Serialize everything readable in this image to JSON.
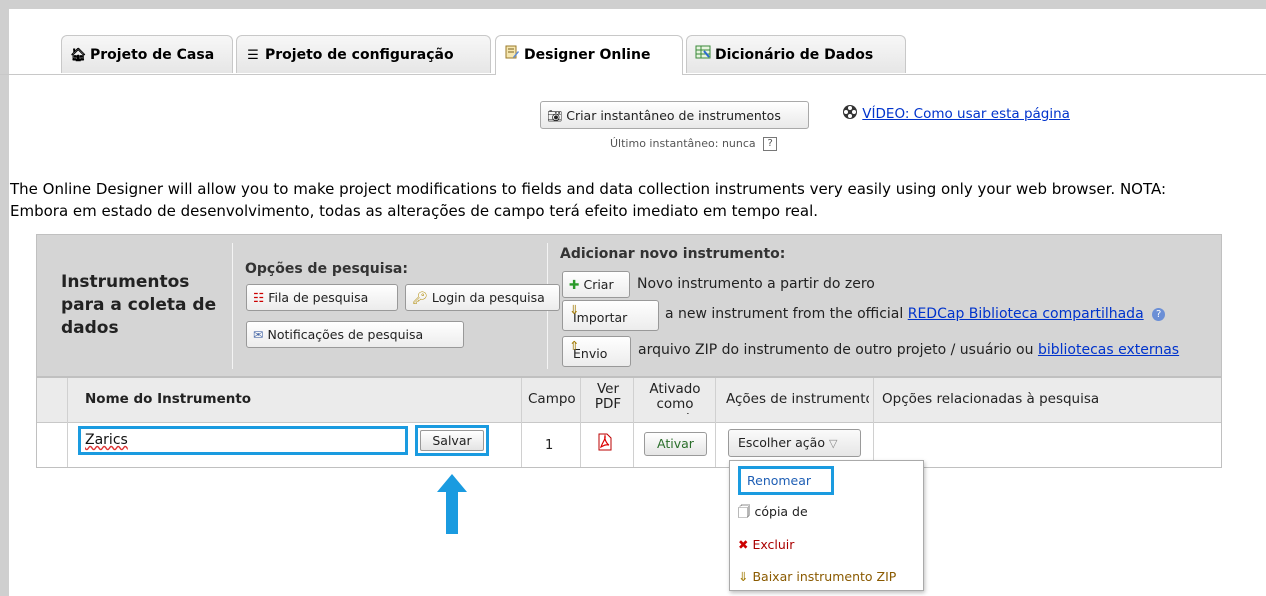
{
  "tabs": [
    {
      "label": "Projeto de Casa",
      "icon": "home-icon",
      "active": false
    },
    {
      "label": "Projeto de configuração",
      "icon": "list-icon",
      "active": false
    },
    {
      "label": "Designer Online",
      "icon": "designer-icon",
      "active": true
    },
    {
      "label": "Dicionário de Dados",
      "icon": "spreadsheet-icon",
      "active": false
    }
  ],
  "snapshot": {
    "button_label": "Criar instantâneo de instrumentos",
    "last_label": "Último instantâneo:",
    "last_value": "nunca",
    "help": "?"
  },
  "video": {
    "link_text": "VÍDEO: Como usar esta página"
  },
  "description": "The Online Designer will allow you to make project modifications to fields and data collection instruments very easily using only your web browser. NOTA: Embora em estado de desenvolvimento, todas as alterações de campo terá efeito imediato em tempo real.",
  "panel": {
    "title": "Instrumentos para a coleta de dados",
    "survey_options_label": "Opções de pesquisa:",
    "survey_queue_button": "Fila de pesquisa",
    "survey_login_button": "Login da pesquisa",
    "survey_notifications_button": "Notificações de pesquisa",
    "add_label": "Adicionar novo instrumento:",
    "create_button": "Criar",
    "create_text": "Novo instrumento a partir do zero",
    "import_button": "Importar",
    "import_text": "a new instrument from the official",
    "import_link": "REDCap Biblioteca compartilhada",
    "upload_button": "Envio",
    "upload_text": "arquivo ZIP do instrumento de outro projeto / usuário ou",
    "upload_link": "bibliotecas externas"
  },
  "table": {
    "headers": {
      "name": "Nome do Instrumento",
      "fields": "Campo",
      "pdf": "Ver PDF",
      "survey_enabled": "Ativado como pesquisa",
      "actions": "Ações de instrumentos",
      "survey_options": "Opções relacionadas à pesquisa"
    },
    "row": {
      "name_value": "Zarics",
      "save_button": "Salvar",
      "fields": "1",
      "enable_button": "Ativar",
      "choose_action": "Escolher ação"
    }
  },
  "action_menu": {
    "rename": "Renomear",
    "copy": "cópia de",
    "delete": "Excluir",
    "download_zip": "Baixar instrumento ZIP"
  },
  "colors": {
    "highlight": "#1a9be0",
    "link": "#0033cc"
  }
}
